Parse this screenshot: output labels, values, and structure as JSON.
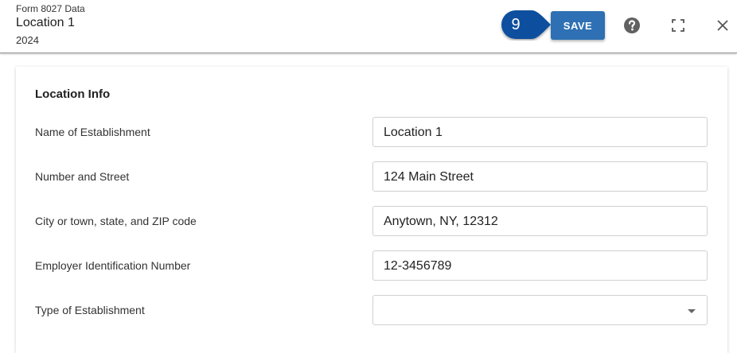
{
  "header": {
    "subtitle": "Form 8027 Data",
    "title": "Location 1",
    "year": "2024",
    "step_number": "9",
    "save_label": "SAVE",
    "icons": [
      "help-icon",
      "fullscreen-icon",
      "close-icon"
    ]
  },
  "section": {
    "title": "Location Info",
    "fields": [
      {
        "label": "Name of Establishment",
        "value": "Location 1"
      },
      {
        "label": "Number and Street",
        "value": "124 Main Street"
      },
      {
        "label": "City or town, state, and ZIP code",
        "value": "Anytown, NY, 12312"
      },
      {
        "label": "Employer Identification Number",
        "value": "12-3456789"
      },
      {
        "label": "Type of Establishment",
        "value": ""
      }
    ]
  },
  "colors": {
    "accent": "#2e70b3",
    "step_badge": "#0d4f9e"
  }
}
